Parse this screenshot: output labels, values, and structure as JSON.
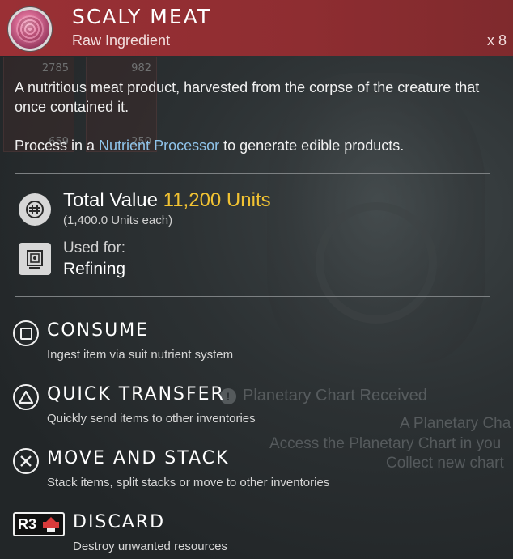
{
  "item": {
    "name": "SCALY MEAT",
    "category": "Raw Ingredient",
    "quantity": "x 8",
    "icon": "scaly-meat-icon",
    "header_color": "#9a3035"
  },
  "description": {
    "line1": "A nutritious meat product, harvested from the corpse of the creature that once contained it.",
    "line2_prefix": "Process in a ",
    "line2_link": "Nutrient Processor",
    "line2_suffix": " to generate edible products.",
    "link_color": "#8fc3ea"
  },
  "value": {
    "label": "Total Value ",
    "amount": "11,200 Units",
    "each": "(1,400.0 Units each)",
    "amount_color": "#f1c232",
    "icon": "units-icon"
  },
  "usage": {
    "label": "Used for:",
    "value": "Refining",
    "icon": "refiner-icon"
  },
  "actions": [
    {
      "title": "CONSUME",
      "desc": "Ingest item via suit nutrient system",
      "button": "square-button-icon"
    },
    {
      "title": "QUICK TRANSFER",
      "desc": "Quickly send items to other inventories",
      "button": "triangle-button-icon"
    },
    {
      "title": "MOVE AND STACK",
      "desc": "Stack items, split stacks or move to other inventories",
      "button": "cross-button-icon"
    },
    {
      "title": "DISCARD",
      "desc": "Destroy unwanted resources",
      "button": "R3"
    }
  ],
  "background": {
    "slots": [
      {
        "top": "2785",
        "bottom": "659"
      },
      {
        "top": "982",
        "bottom": "250"
      }
    ],
    "notification": {
      "title": "Planetary Chart Received",
      "line1": "A Planetary Cha",
      "line2": "Access the Planetary Chart in you",
      "line3": "Collect new chart"
    }
  }
}
